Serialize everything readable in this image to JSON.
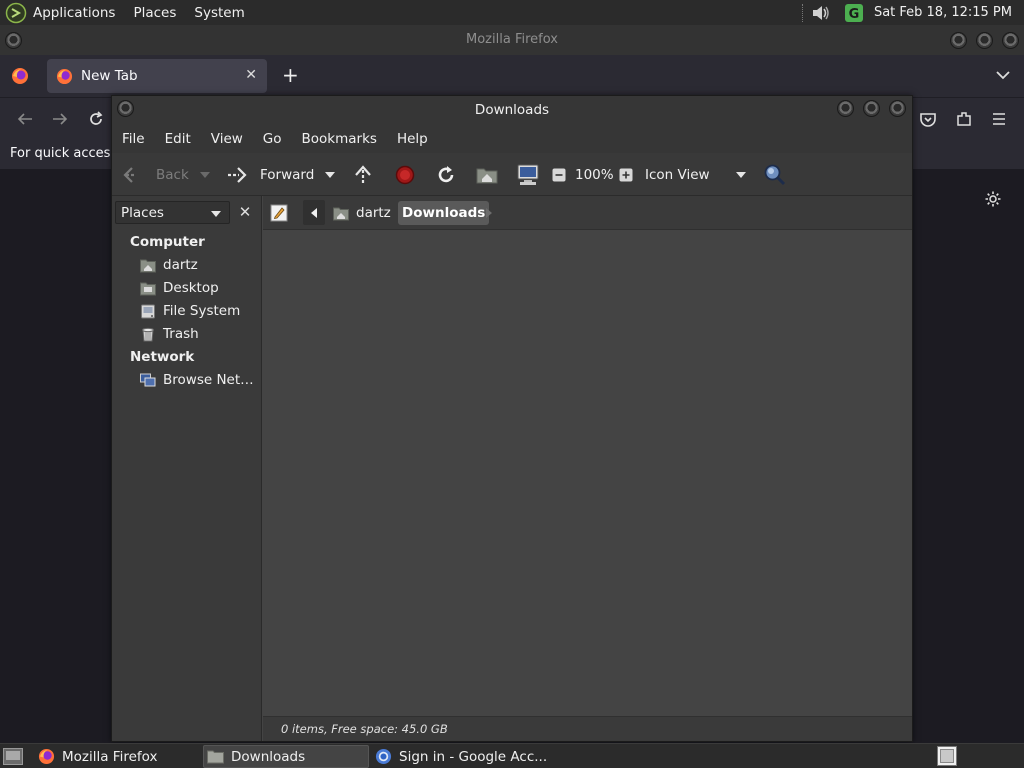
{
  "top_panel": {
    "menus": [
      "Applications",
      "Places",
      "System"
    ],
    "clock": "Sat Feb 18, 12:15 PM"
  },
  "firefox": {
    "window_title": "Mozilla Firefox",
    "tab_label": "New Tab",
    "tab_close": "✕",
    "new_tab": "+",
    "bookmarks_text": "For quick access, place your bookmarks here on the bookmarks toolbar."
  },
  "caja": {
    "window_title": "Downloads",
    "menu": [
      "File",
      "Edit",
      "View",
      "Go",
      "Bookmarks",
      "Help"
    ],
    "toolbar": {
      "back": "Back",
      "forward": "Forward",
      "zoom": "100%",
      "view_mode": "Icon View"
    },
    "sidebar": {
      "selector": "Places",
      "close": "✕",
      "computer_heading": "Computer",
      "computer_items": [
        "dartz",
        "Desktop",
        "File System",
        "Trash"
      ],
      "network_heading": "Network",
      "network_items": [
        "Browse Net…"
      ]
    },
    "path": {
      "home": "dartz",
      "current": "Downloads"
    },
    "status": "0 items, Free space: 45.0 GB"
  },
  "taskbar": {
    "tasks": [
      "Mozilla Firefox",
      "Downloads",
      "Sign in - Google Acc..."
    ]
  }
}
